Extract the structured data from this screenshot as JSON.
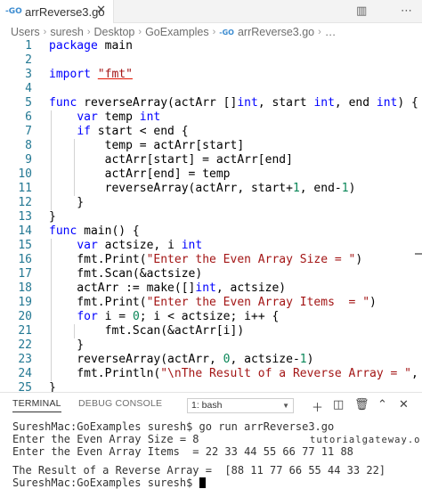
{
  "tab": {
    "icon": "go-file-icon",
    "icon_text": "-GO",
    "filename": "arrReverse3.go"
  },
  "breadcrumb": {
    "items": [
      "Users",
      "suresh",
      "Desktop",
      "GoExamples"
    ],
    "file": "arrReverse3.go",
    "ellipsis": "…",
    "go_text": "-GO"
  },
  "panel": {
    "tabs": [
      "TERMINAL",
      "DEBUG CONSOLE"
    ],
    "terminal_select": "1: bash",
    "terminal_lines": [
      "SureshMac:GoExamples suresh$ go run arrReverse3.go",
      "Enter the Even Array Size = 8",
      "Enter the Even Array Items  = 22 33 44 55 66 77 11 88",
      "",
      "The Result of a Reverse Array =  [88 11 77 66 55 44 33 22]",
      "SureshMac:GoExamples suresh$ "
    ],
    "watermark": "tutorialgateway.org"
  },
  "code_lines": [
    {
      "n": "1",
      "t": "package main"
    },
    {
      "n": "2",
      "t": ""
    },
    {
      "n": "3",
      "t": "import \"fmt\""
    },
    {
      "n": "4",
      "t": ""
    },
    {
      "n": "5",
      "t": "func reverseArray(actArr []int, start int, end int) {"
    },
    {
      "n": "6",
      "t": "    var temp int"
    },
    {
      "n": "7",
      "t": "    if start < end {"
    },
    {
      "n": "8",
      "t": "        temp = actArr[start]"
    },
    {
      "n": "9",
      "t": "        actArr[start] = actArr[end]"
    },
    {
      "n": "10",
      "t": "        actArr[end] = temp"
    },
    {
      "n": "11",
      "t": "        reverseArray(actArr, start+1, end-1)"
    },
    {
      "n": "12",
      "t": "    }"
    },
    {
      "n": "13",
      "t": "}"
    },
    {
      "n": "14",
      "t": "func main() {"
    },
    {
      "n": "15",
      "t": "    var actsize, i int"
    },
    {
      "n": "16",
      "t": "    fmt.Print(\"Enter the Even Array Size = \")"
    },
    {
      "n": "17",
      "t": "    fmt.Scan(&actsize)"
    },
    {
      "n": "18",
      "t": "    actArr := make([]int, actsize)"
    },
    {
      "n": "19",
      "t": "    fmt.Print(\"Enter the Even Array Items  = \")"
    },
    {
      "n": "20",
      "t": "    for i = 0; i < actsize; i++ {"
    },
    {
      "n": "21",
      "t": "        fmt.Scan(&actArr[i])"
    },
    {
      "n": "22",
      "t": "    }"
    },
    {
      "n": "23",
      "t": "    reverseArray(actArr, 0, actsize-1)"
    },
    {
      "n": "24",
      "t": "    fmt.Println(\"\\nThe Result of a Reverse Array = \", actArr)"
    },
    {
      "n": "25",
      "t": "}"
    }
  ]
}
